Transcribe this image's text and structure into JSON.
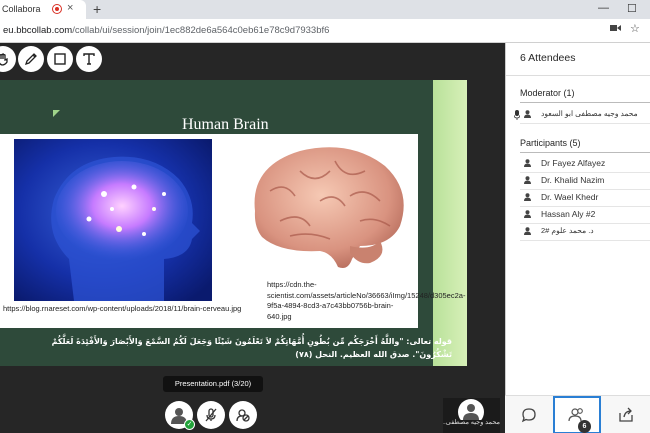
{
  "browser": {
    "tab_title": "Collabora",
    "url_host": "eu.bbcollab.com",
    "url_path": "/collab/ui/session/join/1ec882de6a564c0eb61e78c9d7933bf6",
    "new_tab": "+",
    "tab_close": "×"
  },
  "slide": {
    "title": "Human Brain",
    "caption_left": "https://blog.rnareset.com/wp-content/uploads/2018/11/brain-cerveau.jpg",
    "caption_right": "https://cdn.the-scientist.com/assets/articleNo/36663/iImg/15248/d305ec2a-9f5a-4894-8cd3-a7c43bb0756b-brain-640.jpg",
    "verse": "قوله تعالى: \"واللَّهُ أَخْرَجَكُم مِّن بُطُونِ أُمَّهَاتِكُمْ لاَ تَعْلَمُونَ شَيْئًا وَجَعَلَ لَكُمُ السَّمْعَ وَالأَبْصَارَ وَالأَفْئِدَةَ لَعَلَّكُمْ تَشْكُرُونَ\". صدق الله العظيم. النحل (٧٨)"
  },
  "presentation": {
    "file": "Presentation.pdf",
    "page": "(3/20)"
  },
  "self_video_name": "محمد وجيه مصطفى...",
  "panel": {
    "title": "6 Attendees",
    "moderator_header": "Moderator (1)",
    "moderator": "محمد وجيه مصطفى ابو السعود",
    "participants_header": "Participants (5)",
    "participants": [
      {
        "name": "Dr Fayez Alfayez",
        "rtl": false
      },
      {
        "name": "Dr. Khalid Nazim",
        "rtl": false
      },
      {
        "name": "Dr. Wael Khedr",
        "rtl": false
      },
      {
        "name": "Hassan Aly #2",
        "rtl": false
      },
      {
        "name": "د. محمد علوم #2",
        "rtl": true
      }
    ],
    "attendee_badge": "6"
  },
  "icons": {
    "toolbar": [
      "select-icon",
      "pen-icon",
      "shape-icon",
      "text-icon"
    ],
    "controls": [
      "avatar-icon",
      "mic-muted-icon",
      "camera-off-icon"
    ],
    "footer": [
      "chat-icon",
      "attendees-icon",
      "share-icon"
    ]
  },
  "colors": {
    "slide_bg": "#2e4a3a",
    "accent_blue": "#2a7fd4",
    "recording_red": "#d93025",
    "status_green": "#22a33a"
  }
}
